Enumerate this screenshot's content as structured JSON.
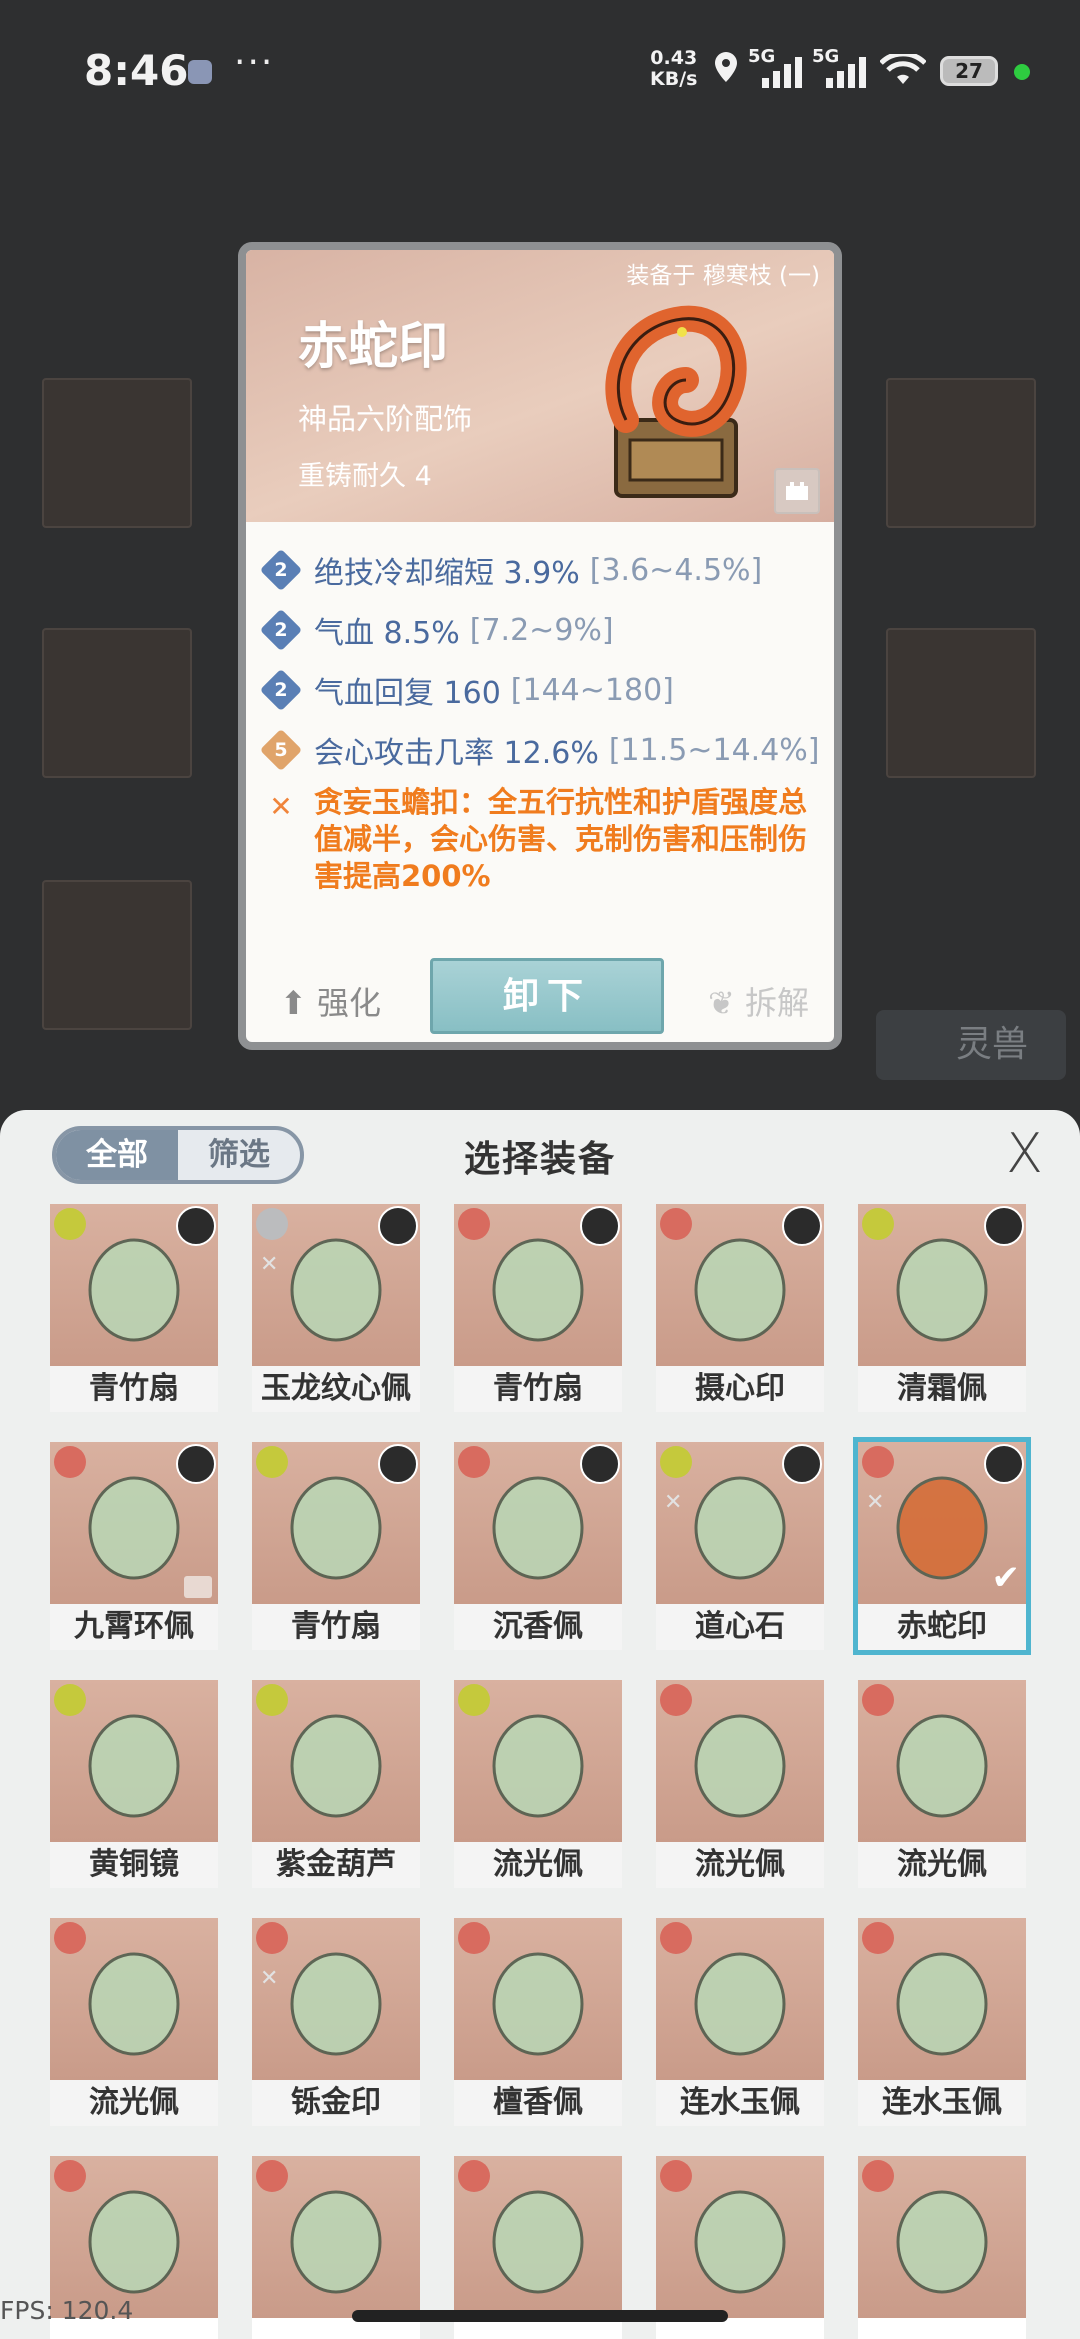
{
  "status_bar": {
    "time": "8:46",
    "more": "···",
    "net_speed_value": "0.43",
    "net_speed_unit": "KB/s",
    "signal_1": "5G",
    "signal_2": "5G",
    "battery": "27"
  },
  "background": {
    "beast_label": "灵兽"
  },
  "detail_card": {
    "equipped_by": "装备于 穆寒枝 (一)",
    "name": "赤蛇印",
    "grade": "神品六阶配饰",
    "durability": "重铸耐久 4",
    "stats": [
      {
        "badge": "2",
        "text": "绝技冷却缩短 3.9%",
        "range": "[3.6~4.5%]",
        "badge_color": "blue"
      },
      {
        "badge": "2",
        "text": "气血 8.5%",
        "range": "[7.2~9%]",
        "badge_color": "blue"
      },
      {
        "badge": "2",
        "text": "气血回复 160",
        "range": "[144~180]",
        "badge_color": "blue"
      },
      {
        "badge": "5",
        "text": "会心攻击几率 12.6%",
        "range": "[11.5~14.4%]",
        "badge_color": "gold"
      }
    ],
    "set_effect": "贪妄玉蟾扣：全五行抗性和护盾强度总值减半，会心伤害、克制伤害和压制伤害提高200%",
    "enhance_label": "强化",
    "unequip_label": "卸下",
    "dismantle_label": "拆解"
  },
  "panel": {
    "filter_all": "全部",
    "filter_screen": "筛选",
    "title": "选择装备",
    "close": "X",
    "items": [
      {
        "name": "青竹扇",
        "element": "wood",
        "avatar": true,
        "set": false,
        "selected": false
      },
      {
        "name": "玉龙纹心佩",
        "element": "metal",
        "avatar": true,
        "set": true,
        "selected": false
      },
      {
        "name": "青竹扇",
        "element": "water",
        "avatar": true,
        "set": false,
        "selected": false
      },
      {
        "name": "摄心印",
        "element": "water",
        "avatar": true,
        "set": false,
        "selected": false
      },
      {
        "name": "清霜佩",
        "element": "wood",
        "avatar": true,
        "set": false,
        "selected": false
      },
      {
        "name": "九霄环佩",
        "element": "water",
        "avatar": true,
        "set": false,
        "selected": false,
        "locked": true
      },
      {
        "name": "青竹扇",
        "element": "wood",
        "avatar": true,
        "set": false,
        "selected": false
      },
      {
        "name": "沉香佩",
        "element": "water",
        "avatar": true,
        "set": false,
        "selected": false
      },
      {
        "name": "道心石",
        "element": "wood",
        "avatar": true,
        "set": true,
        "selected": false
      },
      {
        "name": "赤蛇印",
        "element": "water",
        "avatar": true,
        "set": true,
        "selected": true
      },
      {
        "name": "黄铜镜",
        "element": "wood",
        "avatar": false,
        "set": false,
        "selected": false
      },
      {
        "name": "紫金葫芦",
        "element": "wood",
        "avatar": false,
        "set": false,
        "selected": false
      },
      {
        "name": "流光佩",
        "element": "wood",
        "avatar": false,
        "set": false,
        "selected": false
      },
      {
        "name": "流光佩",
        "element": "water",
        "avatar": false,
        "set": false,
        "selected": false
      },
      {
        "name": "流光佩",
        "element": "water",
        "avatar": false,
        "set": false,
        "selected": false
      },
      {
        "name": "流光佩",
        "element": "water",
        "avatar": false,
        "set": false,
        "selected": false
      },
      {
        "name": "铄金印",
        "element": "water",
        "avatar": false,
        "set": true,
        "selected": false
      },
      {
        "name": "檀香佩",
        "element": "water",
        "avatar": false,
        "set": false,
        "selected": false
      },
      {
        "name": "连水玉佩",
        "element": "water",
        "avatar": false,
        "set": false,
        "selected": false
      },
      {
        "name": "连水玉佩",
        "element": "water",
        "avatar": false,
        "set": false,
        "selected": false
      },
      {
        "name": "",
        "element": "water",
        "avatar": false,
        "set": false,
        "selected": false
      },
      {
        "name": "",
        "element": "water",
        "avatar": false,
        "set": false,
        "selected": false
      },
      {
        "name": "",
        "element": "water",
        "avatar": false,
        "set": false,
        "selected": false
      },
      {
        "name": "",
        "element": "water",
        "avatar": false,
        "set": false,
        "selected": false
      },
      {
        "name": "",
        "element": "water",
        "avatar": false,
        "set": false,
        "selected": false
      }
    ]
  },
  "fps": "FPS: 120.4"
}
